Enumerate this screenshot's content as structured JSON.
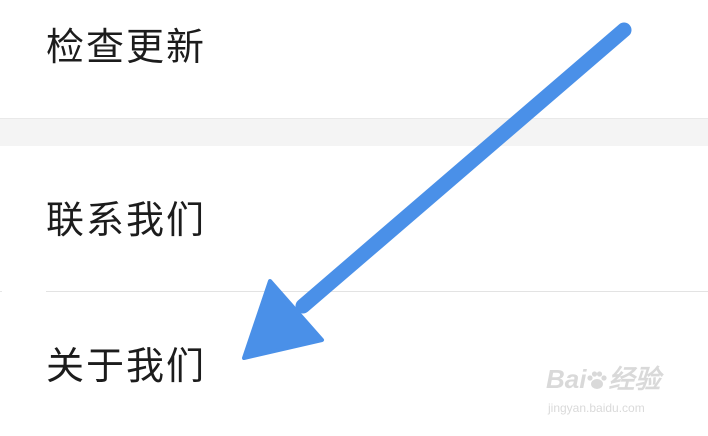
{
  "settings_menu": {
    "items": [
      {
        "label": "检查更新"
      },
      {
        "label": "联系我们"
      },
      {
        "label": "关于我们"
      }
    ]
  },
  "annotation": {
    "arrow_icon": "arrow-pointing-to-about-us",
    "arrow_color": "#4a90e8"
  },
  "watermark": {
    "brand_prefix": "Bai",
    "brand_suffix": "经验",
    "site": "jingyan.baidu.com"
  }
}
